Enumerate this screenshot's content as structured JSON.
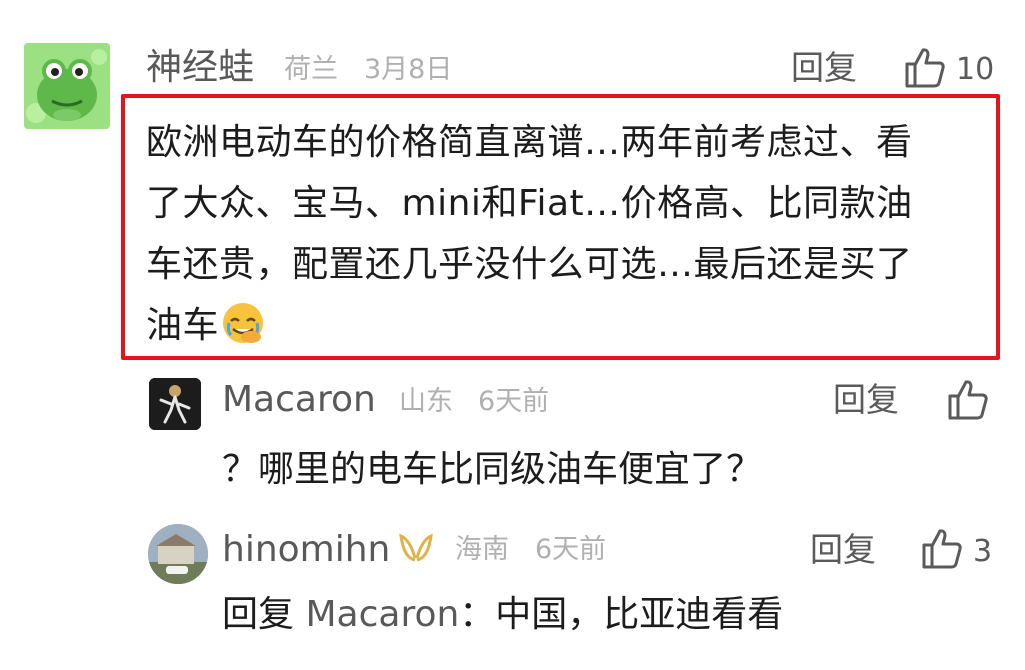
{
  "comment": {
    "author": "神经蛙",
    "location": "荷兰",
    "date": "3月8日",
    "reply_label": "回复",
    "like_count": "10",
    "text_lines": [
      "欧洲电动车的价格简直离谱…两年前考虑过、看",
      "了大众、宝马、mini和Fiat…价格高、比同款油",
      "车还贵，配置还几乎没什么可选…最后还是买了",
      "油车"
    ],
    "emoji": "face-palm-crying-emoji",
    "highlight_color": "#e3141b"
  },
  "replies": [
    {
      "author": "Macaron",
      "location": "山东",
      "time": "6天前",
      "reply_label": "回复",
      "like_count": "",
      "text": "？哪里的电车比同级油车便宜了？"
    },
    {
      "author": "hinomihn",
      "location": "海南",
      "time": "6天前",
      "reply_label": "回复",
      "like_count": "3",
      "text_prefix": "回复",
      "text_mention": "Macaron",
      "text_body": "：中国，比亚迪看看",
      "badge": "gold-wings-badge"
    }
  ]
}
